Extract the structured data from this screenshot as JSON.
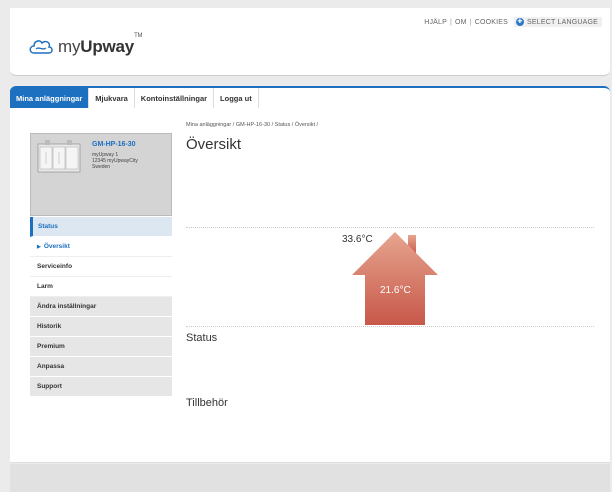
{
  "header": {
    "links": [
      "HJÄLP",
      "OM",
      "COOKIES"
    ],
    "language_label": "SELECT LANGUAGE",
    "logo_text_pre": "my",
    "logo_text_bold": "Upway",
    "logo_tm": "TM"
  },
  "nav": {
    "items": [
      "Mina anläggningar",
      "Mjukvara",
      "Kontoinställningar",
      "Logga ut"
    ],
    "active_index": 0
  },
  "device": {
    "name": "GM-HP-16-30",
    "lines": [
      "myUpway 1",
      "12345 myUpwayCity",
      "Sweden"
    ]
  },
  "sidebar": {
    "items": [
      {
        "label": "Status"
      },
      {
        "label": "Översikt"
      },
      {
        "label": "Serviceinfo"
      },
      {
        "label": "Larm"
      },
      {
        "label": "Ändra inställningar"
      },
      {
        "label": "Historik"
      },
      {
        "label": "Premium"
      },
      {
        "label": "Anpassa"
      },
      {
        "label": "Support"
      }
    ]
  },
  "breadcrumb": "Mina anläggningar / GM-HP-16-30 / Status / Översikt /",
  "page_title": "Översikt",
  "overview": {
    "outdoor_temp": "33.6°C",
    "indoor_temp": "21.6°C"
  },
  "sections": {
    "status": "Status",
    "accessories": "Tillbehör"
  },
  "colors": {
    "accent": "#1d6fbf",
    "house_top": "#e6a58f",
    "house_bottom": "#c8584a"
  }
}
